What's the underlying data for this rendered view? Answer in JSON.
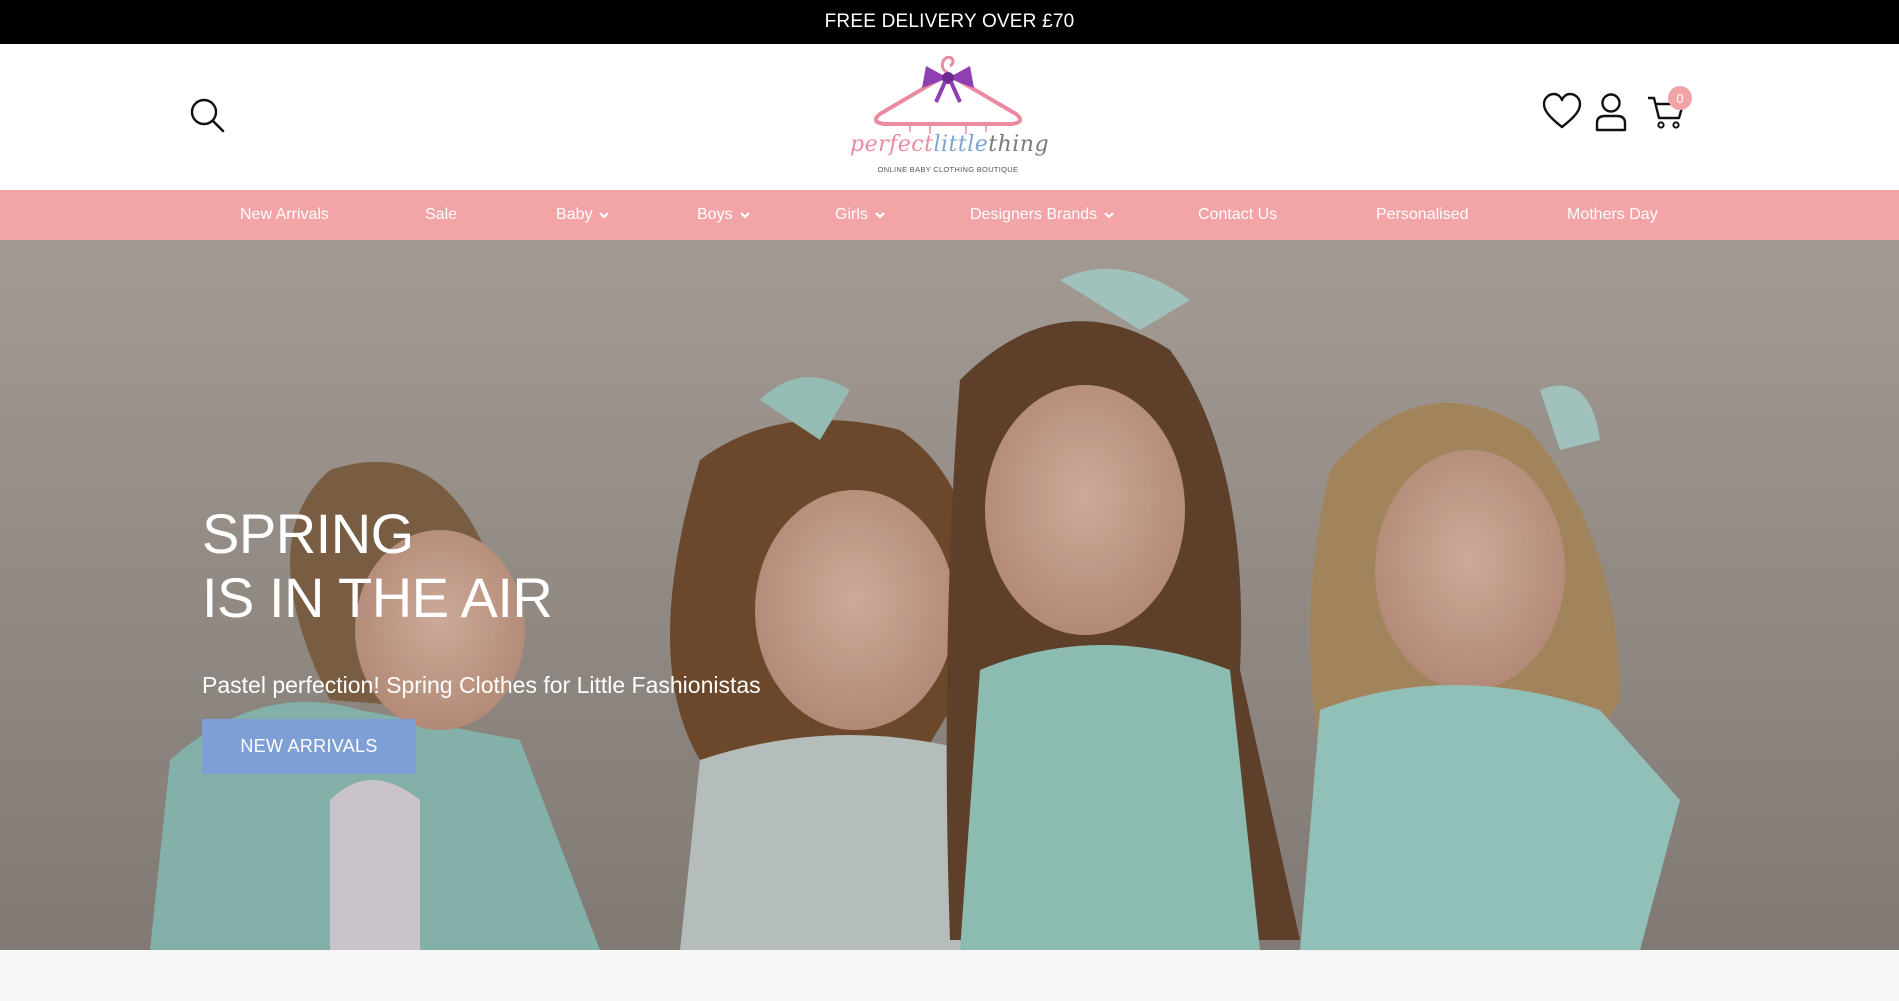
{
  "topbar": {
    "text": "FREE DELIVERY OVER £70"
  },
  "header": {
    "logo": {
      "word1": "perfect",
      "word2": "little",
      "word3": "thing",
      "tagline": "ONLINE BABY CLOTHING BOUTIQUE"
    },
    "cart_count": "0",
    "icons": [
      "search-icon",
      "heart-icon",
      "user-icon",
      "cart-icon"
    ]
  },
  "nav": {
    "items": [
      {
        "label": "New Arrivals",
        "dropdown": false
      },
      {
        "label": "Sale",
        "dropdown": false
      },
      {
        "label": "Baby",
        "dropdown": true
      },
      {
        "label": "Boys",
        "dropdown": true
      },
      {
        "label": "Girls",
        "dropdown": true
      },
      {
        "label": "Designers Brands",
        "dropdown": true
      },
      {
        "label": "Contact Us",
        "dropdown": false
      },
      {
        "label": "Personalised",
        "dropdown": false
      },
      {
        "label": "Mothers Day",
        "dropdown": false
      }
    ]
  },
  "hero": {
    "title_line1": "SPRING",
    "title_line2": "IS IN THE AIR",
    "subtitle": "Pastel perfection! Spring Clothes for Little Fashionistas",
    "button_label": "NEW ARRIVALS"
  },
  "colors": {
    "topbar_bg": "#000000",
    "nav_bg": "#f2a4a6",
    "button_bg": "#7d9fd6",
    "cart_badge": "#f2a3a6",
    "logo_pink": "#ec8aa0",
    "logo_blue": "#7fa4d8",
    "bow_purple": "#8e3fb0"
  }
}
